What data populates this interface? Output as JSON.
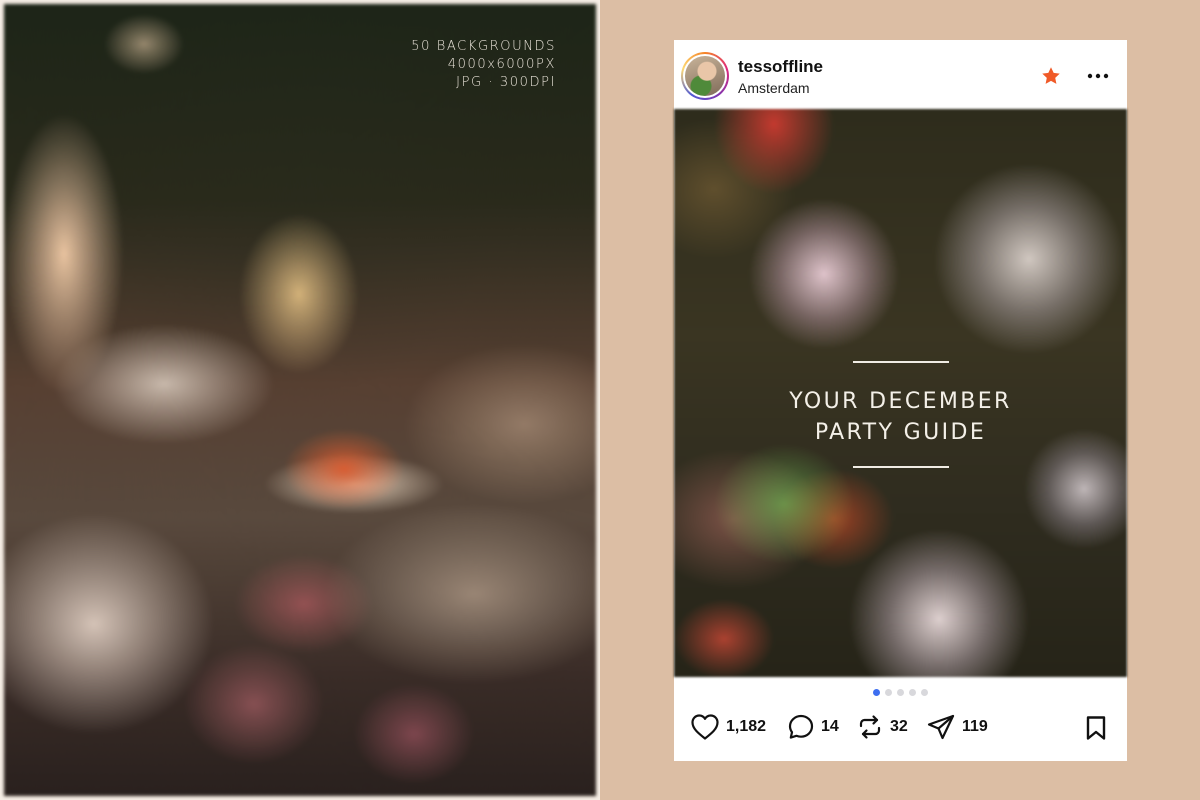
{
  "left_panel": {
    "caption_lines": [
      "50 BACKGROUNDS",
      "4000x6000PX",
      "JPG · 300DPI"
    ]
  },
  "post": {
    "username": "tessoffline",
    "location": "Amsterdam",
    "headline_lines": [
      "YOUR DECEMBER",
      "PARTY GUIDE"
    ],
    "carousel": {
      "total": 5,
      "active_index": 0
    },
    "actions": {
      "likes": "1,182",
      "comments": "14",
      "reposts": "32",
      "shares": "119"
    },
    "icons": {
      "favorite": "star-icon",
      "more": "more-options-icon",
      "like": "heart-icon",
      "comment": "comment-bubble-icon",
      "repost": "repost-arrows-icon",
      "share": "send-paper-plane-icon",
      "save": "bookmark-icon"
    },
    "colors": {
      "star": "#f05a28",
      "active_dot": "#3d6ef0",
      "inactive_dot": "#d8d8dc"
    }
  },
  "page": {
    "background_color": "#dcbea4"
  }
}
